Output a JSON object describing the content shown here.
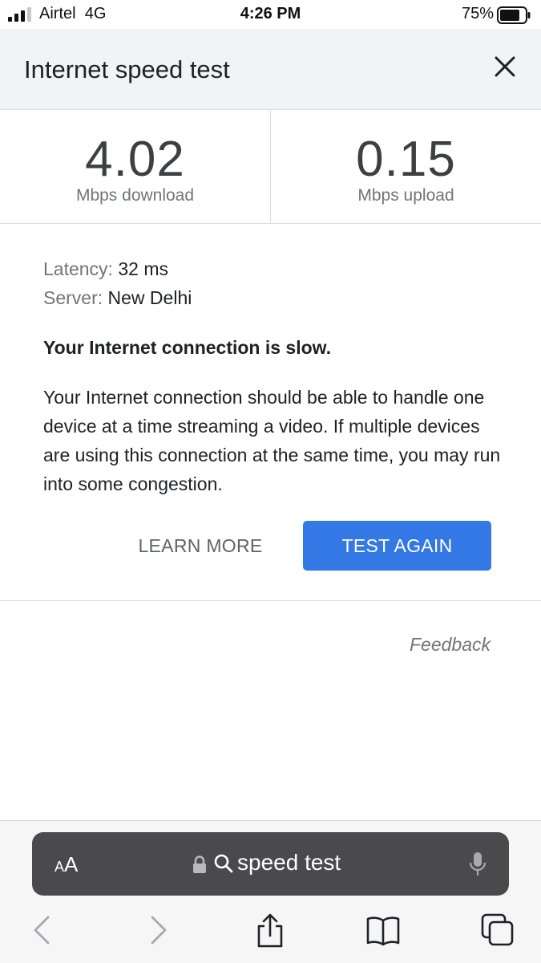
{
  "status_bar": {
    "carrier": "Airtel",
    "network": "4G",
    "time": "4:26 PM",
    "battery": "75%",
    "battery_level": 0.75
  },
  "header": {
    "title": "Internet speed test",
    "close_icon": "close-icon"
  },
  "metrics": {
    "download": {
      "value": "4.02",
      "label": "Mbps download"
    },
    "upload": {
      "value": "0.15",
      "label": "Mbps upload"
    }
  },
  "details": {
    "latency_label": "Latency:",
    "latency_value": "32 ms",
    "server_label": "Server:",
    "server_value": "New Delhi",
    "verdict": "Your Internet connection is slow.",
    "description": "Your Internet connection should be able to handle one device at a time streaming a video. If multiple devices are using this connection at the same time, you may run into some congestion."
  },
  "actions": {
    "learn_more": "LEARN MORE",
    "test_again": "TEST AGAIN"
  },
  "feedback": "Feedback",
  "browser": {
    "text_size_small": "A",
    "text_size_big": "A",
    "address": "speed test",
    "accent": "#3478e5"
  }
}
